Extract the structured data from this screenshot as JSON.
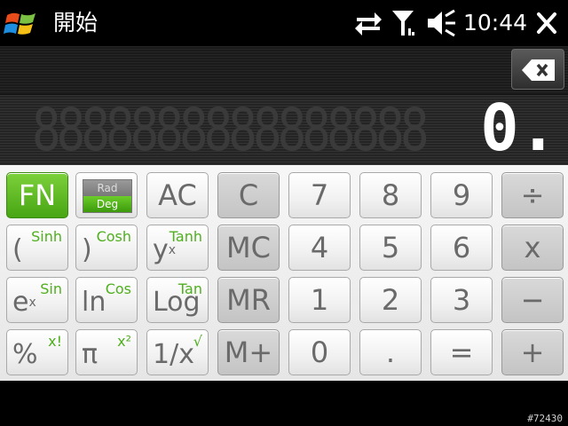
{
  "status_bar": {
    "title": "開始",
    "time": "10:44"
  },
  "display": {
    "ghost_digits": "8888888888888888",
    "value": "0."
  },
  "keys": {
    "fn": "FN",
    "rad": "Rad",
    "deg": "Deg",
    "ac": "AC",
    "c": "C",
    "seven": "7",
    "eight": "8",
    "nine": "9",
    "divide": "÷",
    "open_paren": "(",
    "open_paren_alt": "Sinh",
    "close_paren": ")",
    "close_paren_alt": "Cosh",
    "power_base": "y",
    "power_exp": "x",
    "power_alt": "Tanh",
    "mc": "MC",
    "four": "4",
    "five": "5",
    "six": "6",
    "multiply": "x",
    "exp_base": "e",
    "exp_exp": "x",
    "exp_alt": "Sin",
    "ln": "ln",
    "ln_alt": "Cos",
    "log": "Log",
    "log_alt": "Tan",
    "mr": "MR",
    "one": "1",
    "two": "2",
    "three": "3",
    "minus": "−",
    "percent": "%",
    "percent_alt": "x!",
    "pi": "π",
    "pi_alt": "x²",
    "reciprocal": "1/x",
    "reciprocal_alt": "√",
    "mplus": "M+",
    "zero": "0",
    "dot": ".",
    "equals": "=",
    "plus": "+"
  },
  "colors": {
    "accent_green": "#4faf1e",
    "fn_green": "#5cbf22"
  },
  "watermark": "#72430"
}
